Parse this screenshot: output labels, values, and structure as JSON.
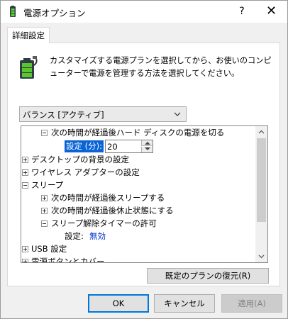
{
  "window": {
    "title": "電源オプション",
    "help_label": "?",
    "close_label": "✕",
    "icon": "power-options-icon"
  },
  "tab": {
    "label": "詳細設定"
  },
  "panel": {
    "icon": "battery-plug-icon",
    "description": "カスタマイズする電源プランを選択してから、お使いのコンピューターで電源を管理する方法を選択してください。"
  },
  "plan_select": {
    "value": "バランス [アクティブ]"
  },
  "tree": {
    "items": [
      {
        "label": "次の時間が経過後ハード ディスクの電源を切る",
        "expander": "minus"
      },
      {
        "setting_label": "設定 (分):",
        "setting_value": "20"
      },
      {
        "label": "デスクトップの背景の設定",
        "expander": "plus"
      },
      {
        "label": "ワイヤレス アダプターの設定",
        "expander": "plus"
      },
      {
        "label": "スリープ",
        "expander": "minus"
      },
      {
        "label": "次の時間が経過後スリープする",
        "expander": "plus"
      },
      {
        "label": "次の時間が経過後休止状態にする",
        "expander": "plus"
      },
      {
        "label": "スリープ解除タイマーの許可",
        "expander": "minus"
      },
      {
        "setting_label": "設定:",
        "setting_value": "無効"
      },
      {
        "label": "USB 設定",
        "expander": "plus"
      },
      {
        "label": "電源ボタンとカバー",
        "expander": "plus"
      }
    ]
  },
  "restore_button": {
    "label": "既定のプランの復元(R)"
  },
  "footer": {
    "ok_label": "OK",
    "cancel_label": "キャンセル",
    "apply_label": "適用(A)"
  },
  "colors": {
    "selection": "#0a64d6",
    "setting_value": "#0033cc",
    "dialog_bg": "#f0f0f0"
  }
}
